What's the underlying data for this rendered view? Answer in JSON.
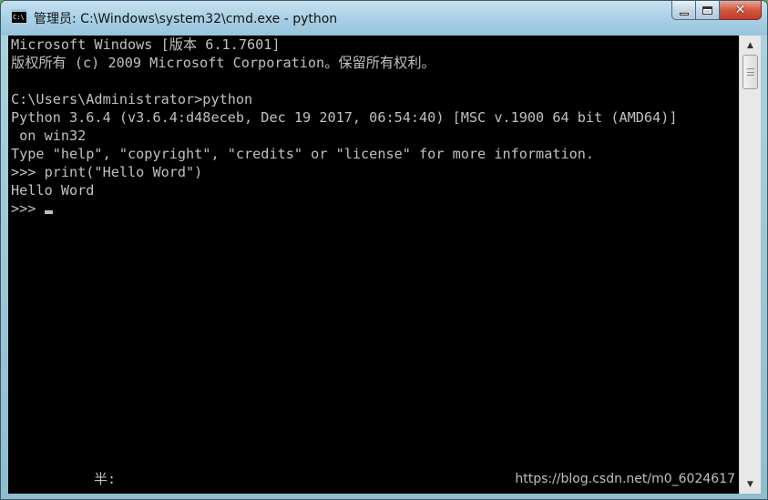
{
  "window": {
    "title": "管理员: C:\\Windows\\system32\\cmd.exe - python",
    "icon": "cmd-icon",
    "icon_text": "C:\\",
    "close_glyph": "✕"
  },
  "console": {
    "lines": [
      "Microsoft Windows [版本 6.1.7601]",
      "版权所有 (c) 2009 Microsoft Corporation。保留所有权利。",
      "",
      "C:\\Users\\Administrator>python",
      "Python 3.6.4 (v3.6.4:d48eceb, Dec 19 2017, 06:54:40) [MSC v.1900 64 bit (AMD64)]",
      " on win32",
      "Type \"help\", \"copyright\", \"credits\" or \"license\" for more information.",
      ">>> print(\"Hello Word\")",
      "Hello Word"
    ],
    "prompt": ">>> ",
    "ime_status": "半:",
    "watermark": "https://blog.csdn.net/m0_6024617"
  },
  "scrollbar": {
    "up_glyph": "▲",
    "down_glyph": "▼"
  },
  "colors": {
    "console_bg": "#000000",
    "console_text": "#c0c0c0",
    "close_button": "#c0392b"
  }
}
